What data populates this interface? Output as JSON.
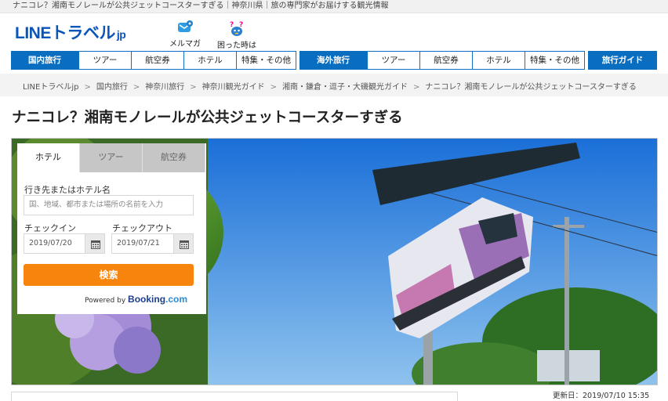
{
  "topbar": {
    "text": "ナニコレ？湘南モノレールが公共ジェットコースターすぎる｜神奈川県｜旅の専門家がお届けする観光情報"
  },
  "header": {
    "logo_main": "LINEトラベル",
    "logo_suffix": "jp",
    "mail_label": "メルマガ",
    "help_label": "困った時は"
  },
  "nav": {
    "domestic_label": "国内旅行",
    "domestic_items": [
      "ツアー",
      "航空券",
      "ホテル",
      "特集・その他"
    ],
    "overseas_label": "海外旅行",
    "overseas_items": [
      "ツアー",
      "航空券",
      "ホテル",
      "特集・その他"
    ],
    "guide_label": "旅行ガイド"
  },
  "breadcrumb": [
    "LINEトラベルjp",
    "国内旅行",
    "神奈川旅行",
    "神奈川観光ガイド",
    "湘南・鎌倉・逗子・大磯観光ガイド",
    "ナニコレ？湘南モノレールが公共ジェットコースターすぎる"
  ],
  "breadcrumb_sep": ">",
  "page_title": "ナニコレ？湘南モノレールが公共ジェットコースターすぎる",
  "search": {
    "tabs": [
      "ホテル",
      "ツアー",
      "航空券"
    ],
    "destination_label": "行き先またはホテル名",
    "destination_placeholder": "国、地域、都市または場所の名前を入力",
    "checkin_label": "チェックイン",
    "checkin_value": "2019/07/20",
    "checkout_label": "チェックアウト",
    "checkout_value": "2019/07/21",
    "search_label": "検索",
    "powered_by": "Powered by",
    "booking_main": "Booking",
    "booking_suffix": ".com"
  },
  "updated": "更新日：2019/07/10 15:35",
  "colors": {
    "brand_blue": "#0a6ec0",
    "search_orange": "#f7840c",
    "logo_blue": "#0a56b8"
  }
}
